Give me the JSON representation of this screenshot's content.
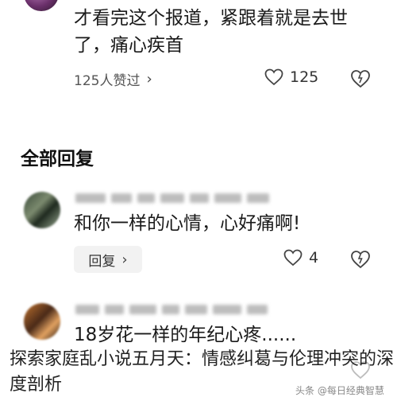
{
  "top_comment": {
    "text": "才看完这个报道，紧跟着就是去世了，痛心疾首",
    "replies_link": "125人赞过",
    "like_count": "125"
  },
  "section_title": "全部回复",
  "replies": [
    {
      "text": "和你一样的心情，心好痛啊!",
      "reply_button": "回复",
      "like_count": "4"
    },
    {
      "text": "18岁花一样的年纪心疼......"
    }
  ],
  "overlay": {
    "title": "探索家庭乱小说五月天：情感纠葛与伦理冲突的深度剖析",
    "watermark": "头条 @每日经典智慧"
  },
  "icons": [
    "heart-icon",
    "dislike-icon",
    "chevron-right-icon"
  ]
}
